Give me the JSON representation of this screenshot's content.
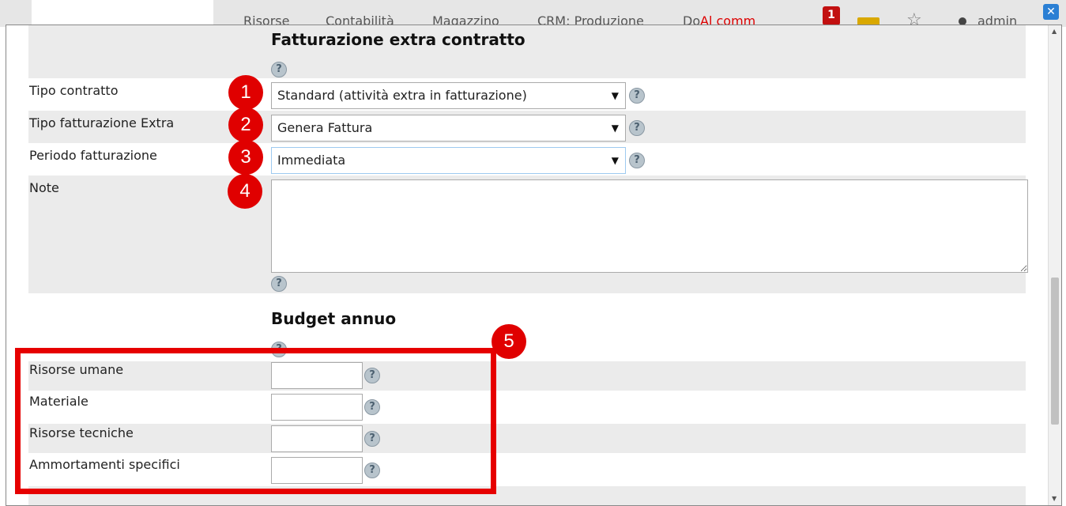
{
  "appbar": {
    "nav_items": [
      "Risorse",
      "Contabilità",
      "Magazzino",
      "CRM: Produzione",
      "Do"
    ],
    "alert_text": "Al comm",
    "notification_count": "1",
    "user": "admin"
  },
  "form": {
    "sections": {
      "extra_billing": "Fatturazione extra contratto",
      "budget": "Budget annuo"
    },
    "fields": {
      "tipo_contratto": {
        "label": "Tipo contratto",
        "value": "Standard (attività extra in fatturazione)"
      },
      "tipo_fatturazione": {
        "label": "Tipo fatturazione Extra",
        "value": "Genera Fattura"
      },
      "periodo_fatturazione": {
        "label": "Periodo fatturazione",
        "value": "Immediata"
      },
      "note": {
        "label": "Note",
        "value": ""
      },
      "risorse_umane": {
        "label": "Risorse umane",
        "value": ""
      },
      "materiale": {
        "label": "Materiale",
        "value": ""
      },
      "risorse_tecniche": {
        "label": "Risorse tecniche",
        "value": ""
      },
      "ammortamenti": {
        "label": "Ammortamenti specifici",
        "value": ""
      }
    },
    "help_glyph": "?",
    "close_glyph": "✕",
    "select_arrow": "▼"
  },
  "annotations": {
    "markers": [
      "1",
      "2",
      "3",
      "4",
      "5"
    ],
    "color": "#e00000"
  }
}
